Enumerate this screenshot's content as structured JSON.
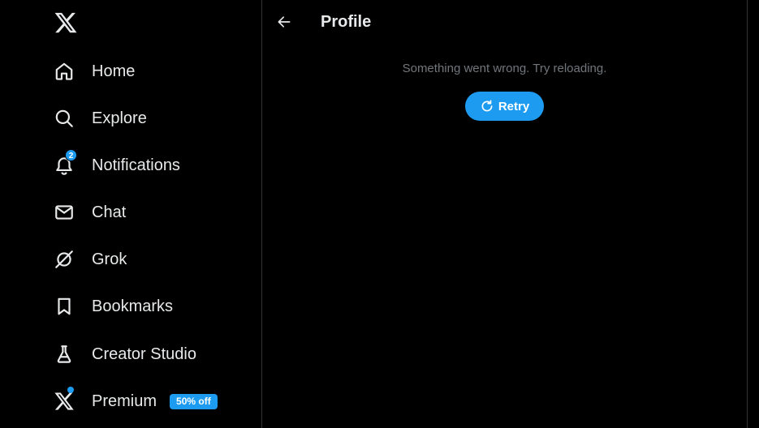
{
  "app": {
    "logo": "x-logo"
  },
  "sidebar": {
    "items": [
      {
        "label": "Home",
        "icon": "home-icon"
      },
      {
        "label": "Explore",
        "icon": "search-icon"
      },
      {
        "label": "Notifications",
        "icon": "bell-icon",
        "badge": "2"
      },
      {
        "label": "Chat",
        "icon": "envelope-icon"
      },
      {
        "label": "Grok",
        "icon": "grok-icon"
      },
      {
        "label": "Bookmarks",
        "icon": "bookmark-icon"
      },
      {
        "label": "Creator Studio",
        "icon": "flask-icon"
      },
      {
        "label": "Premium",
        "icon": "x-logo-icon",
        "promo": "50% off"
      }
    ]
  },
  "main": {
    "title": "Profile",
    "error_message": "Something went wrong. Try reloading.",
    "retry_label": "Retry"
  },
  "colors": {
    "background": "#000000",
    "text": "#e7e9ea",
    "muted": "#71767b",
    "accent": "#1d9bf0",
    "border": "#2f3336"
  }
}
